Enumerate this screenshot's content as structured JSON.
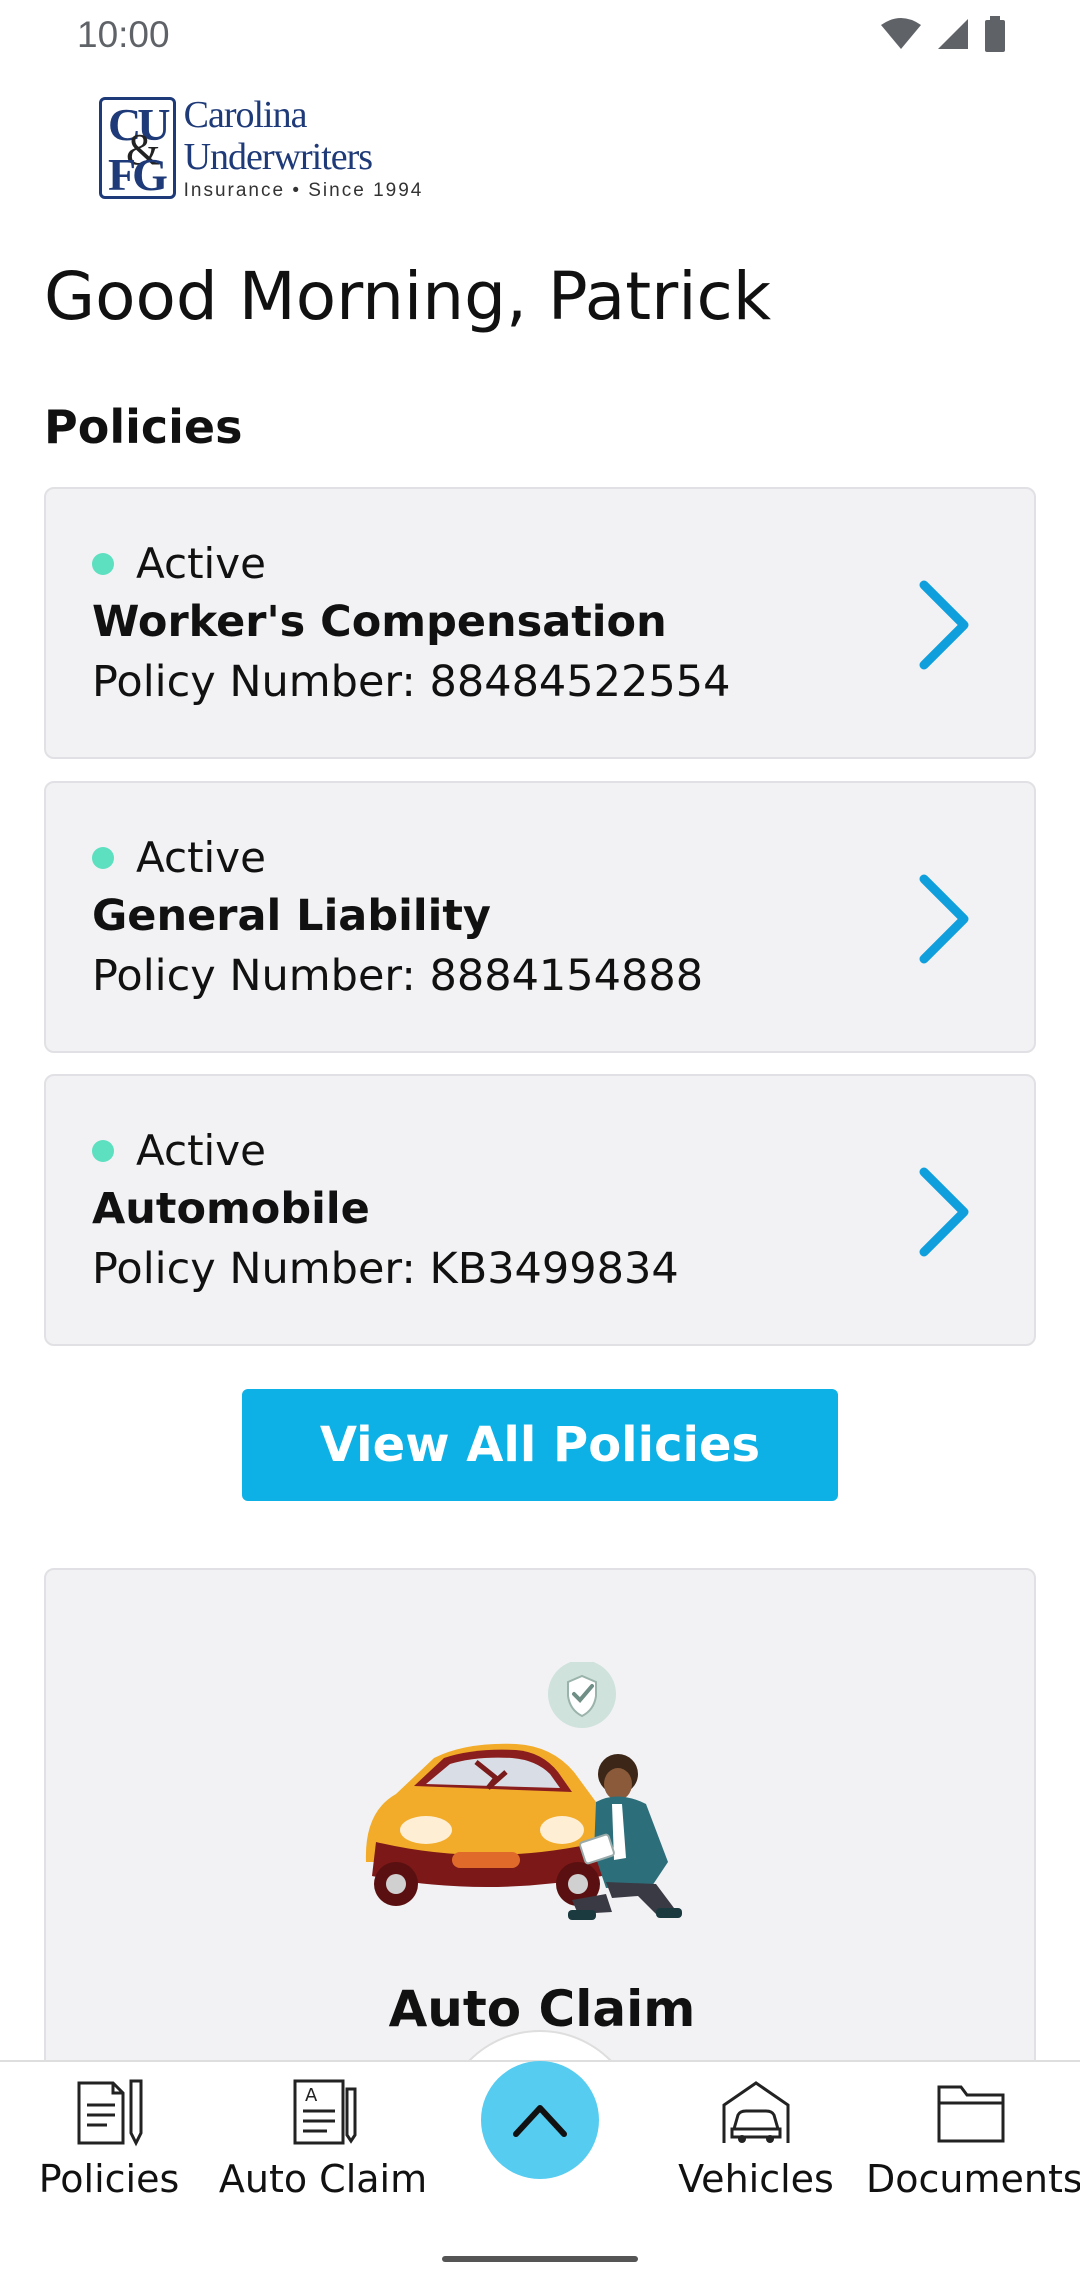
{
  "status_bar": {
    "time": "10:00"
  },
  "brand": {
    "logo_letters": [
      "CU",
      "&",
      "FG"
    ],
    "name": "Carolina Underwriters",
    "tagline": "Insurance  •  Since 1994"
  },
  "greeting": "Good Morning, Patrick",
  "policies_section": {
    "title": "Policies",
    "number_prefix": "Policy Number: ",
    "items": [
      {
        "status": "Active",
        "name": "Worker's Compensation",
        "number": "88484522554"
      },
      {
        "status": "Active",
        "name": "General Liability",
        "number": "8884154888"
      },
      {
        "status": "Active",
        "name": "Automobile",
        "number": "KB3499834"
      }
    ],
    "view_all_label": "View All Policies"
  },
  "claim_card": {
    "title": "Auto Claim"
  },
  "bottom_nav": {
    "items": [
      {
        "label": "Policies",
        "icon": "policy-document-icon"
      },
      {
        "label": "Auto Claim",
        "icon": "claim-form-icon"
      },
      {
        "label": "Vehicles",
        "icon": "garage-car-icon"
      },
      {
        "label": "Documents",
        "icon": "folder-icon"
      }
    ],
    "fab_icon": "chevron-up-icon"
  },
  "colors": {
    "accent": "#0eb1e6",
    "fab": "#55ccf0",
    "active_dot": "#5ce0c0",
    "card_bg": "#f2f2f4",
    "brand_navy": "#1e3a78"
  }
}
